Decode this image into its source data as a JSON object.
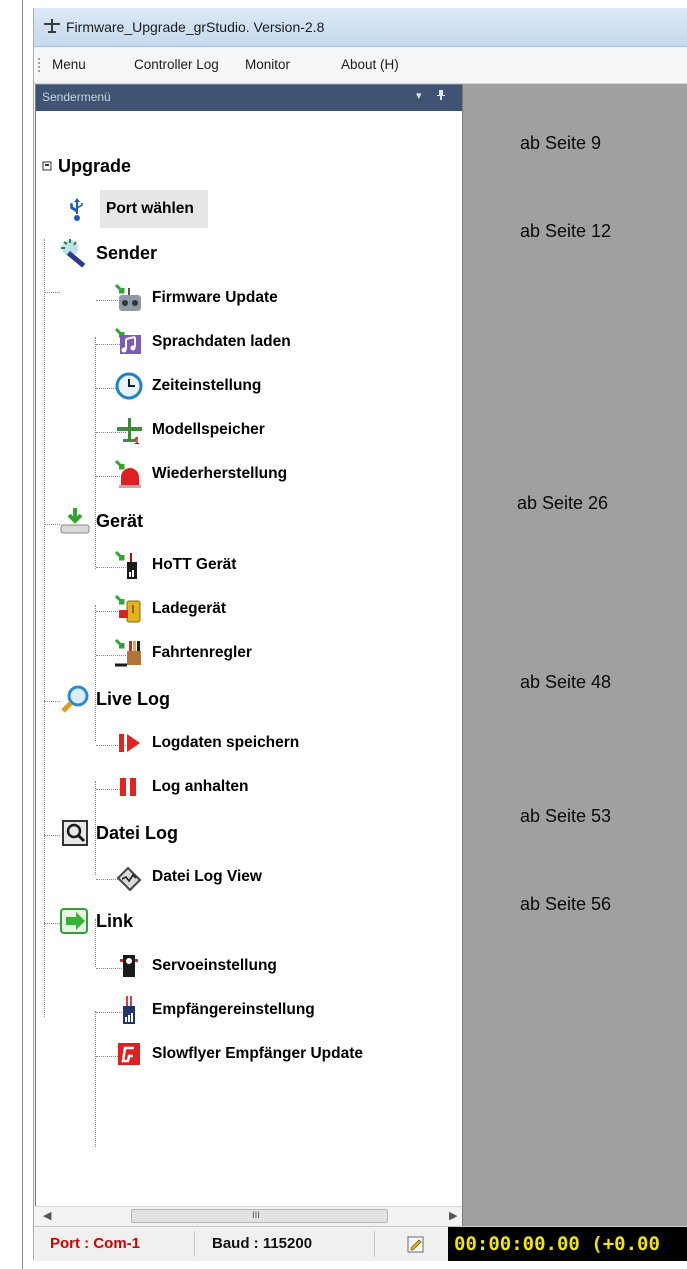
{
  "window": {
    "title": "Firmware_Upgrade_grStudio.   Version-2.8"
  },
  "menu": [
    "Menu",
    "Controller Log",
    "Monitor",
    "About (H)"
  ],
  "panel": {
    "title": "Sendermenü",
    "dropdown_icon": "▾",
    "pin_icon": "pin"
  },
  "tree": [
    {
      "label": "Upgrade",
      "icon": "expand-box-icon",
      "children": [
        {
          "label": "Port wählen",
          "icon": "usb-icon",
          "selected": true
        }
      ]
    },
    {
      "label": "Sender",
      "icon": "magic-wand-icon",
      "children": [
        {
          "label": "Firmware Update",
          "icon": "transmitter-icon"
        },
        {
          "label": "Sprachdaten laden",
          "icon": "music-notes-icon"
        },
        {
          "label": "Zeiteinstellung",
          "icon": "clock-icon"
        },
        {
          "label": "Modellspeicher",
          "icon": "airplane-icon"
        },
        {
          "label": "Wiederherstellung",
          "icon": "red-alarm-icon"
        }
      ]
    },
    {
      "label": "Gerät",
      "icon": "download-device-icon",
      "children": [
        {
          "label": "HoTT Gerät",
          "icon": "hott-device-icon"
        },
        {
          "label": "Ladegerät",
          "icon": "charger-icon"
        },
        {
          "label": "Fahrtenregler",
          "icon": "speed-controller-icon"
        }
      ]
    },
    {
      "label": "Live Log",
      "icon": "magnifier-icon",
      "children": [
        {
          "label": "Logdaten speichern",
          "icon": "record-icon"
        },
        {
          "label": "Log anhalten",
          "icon": "pause-icon"
        }
      ]
    },
    {
      "label": "Datei Log",
      "icon": "file-log-icon",
      "children": [
        {
          "label": "Datei Log View",
          "icon": "log-view-icon"
        }
      ]
    },
    {
      "label": "Link",
      "icon": "link-arrow-icon",
      "children": [
        {
          "label": "Servoeinstellung",
          "icon": "servo-icon"
        },
        {
          "label": "Empfängereinstellung",
          "icon": "receiver-icon"
        },
        {
          "label": "Slowflyer Empfänger Update",
          "icon": "slowflyer-icon"
        }
      ]
    }
  ],
  "page_refs": [
    "ab Seite  9",
    "ab Seite 12",
    "ab Seite 26",
    "ab Seite 48",
    "ab Seite 53",
    "ab Seite 56"
  ],
  "statusbar": {
    "port": "Port : Com-1",
    "baud": "Baud : 115200",
    "timer": "00:00:00.00  (+0.00"
  },
  "colors": {
    "port_text": "#d40000",
    "timer_text": "#f2e600",
    "panel_header": "#3f5472",
    "content_bg": "#a0a0a0"
  }
}
